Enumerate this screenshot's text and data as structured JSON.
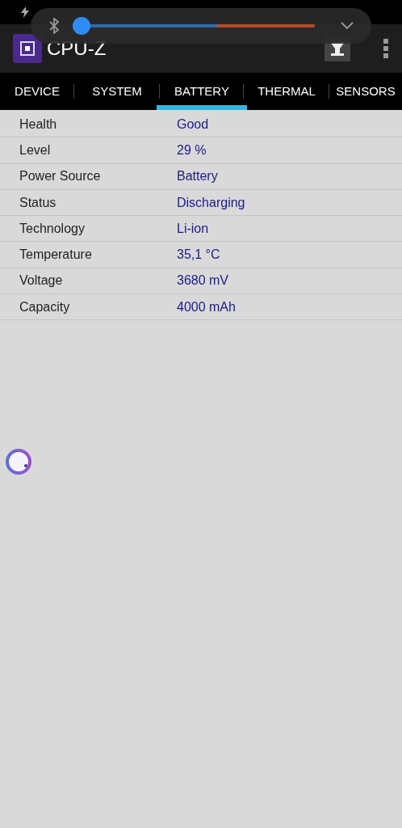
{
  "volume_popup": {
    "level": 0.0
  },
  "app_bar": {
    "title": "CPU-Z"
  },
  "tabs": [
    {
      "label": "DEVICE",
      "selected": false
    },
    {
      "label": "SYSTEM",
      "selected": false
    },
    {
      "label": "BATTERY",
      "selected": true
    },
    {
      "label": "THERMAL",
      "selected": false
    },
    {
      "label": "SENSORS",
      "selected": false
    }
  ],
  "rows": [
    {
      "label": "Health",
      "value": "Good"
    },
    {
      "label": "Level",
      "value": "29 %"
    },
    {
      "label": "Power Source",
      "value": "Battery"
    },
    {
      "label": "Status",
      "value": "Discharging"
    },
    {
      "label": "Technology",
      "value": "Li-ion"
    },
    {
      "label": "Temperature",
      "value": "35,1 °C"
    },
    {
      "label": "Voltage",
      "value": "3680 mV"
    },
    {
      "label": "Capacity",
      "value": "4000 mAh"
    }
  ]
}
